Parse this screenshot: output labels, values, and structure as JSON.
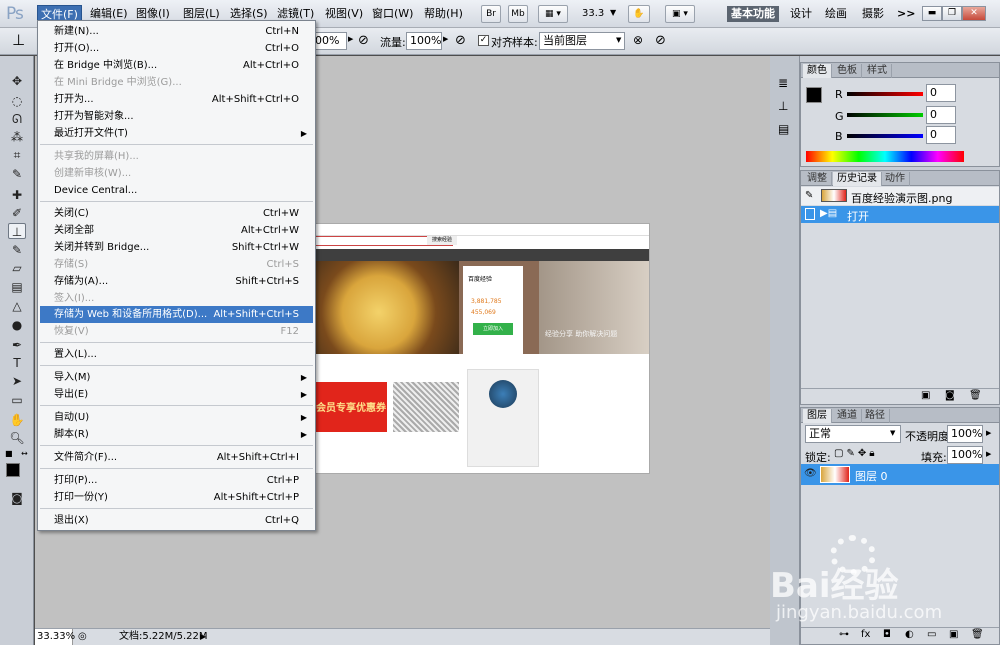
{
  "app": {
    "logo": "Ps"
  },
  "menubar": {
    "items": [
      "文件(F)",
      "编辑(E)",
      "图像(I)",
      "图层(L)",
      "选择(S)",
      "滤镜(T)",
      "视图(V)",
      "窗口(W)",
      "帮助(H)"
    ],
    "br": "Br",
    "mb": "Mb",
    "zoom": "33.3",
    "workspaces": [
      "基本功能",
      "设计",
      "绘画",
      "摄影"
    ],
    "more": ">>"
  },
  "options": {
    "opacity_value": "00%",
    "flow_label": "流量:",
    "flow_value": "100%",
    "align_label": "对齐",
    "sample_label": "样本:",
    "sample_value": "当前图层"
  },
  "file_menu": {
    "items": [
      {
        "label": "新建(N)...",
        "shortcut": "Ctrl+N",
        "state": "normal"
      },
      {
        "label": "打开(O)...",
        "shortcut": "Ctrl+O",
        "state": "normal"
      },
      {
        "label": "在 Bridge 中浏览(B)...",
        "shortcut": "Alt+Ctrl+O",
        "state": "normal"
      },
      {
        "label": "在 Mini Bridge 中浏览(G)...",
        "shortcut": "",
        "state": "disabled"
      },
      {
        "label": "打开为...",
        "shortcut": "Alt+Shift+Ctrl+O",
        "state": "normal"
      },
      {
        "label": "打开为智能对象...",
        "shortcut": "",
        "state": "normal"
      },
      {
        "label": "最近打开文件(T)",
        "shortcut": "",
        "state": "submenu"
      },
      {
        "label": "共享我的屏幕(H)...",
        "shortcut": "",
        "state": "disabled"
      },
      {
        "label": "创建新审核(W)...",
        "shortcut": "",
        "state": "disabled"
      },
      {
        "label": "Device Central...",
        "shortcut": "",
        "state": "normal"
      },
      {
        "label": "关闭(C)",
        "shortcut": "Ctrl+W",
        "state": "normal"
      },
      {
        "label": "关闭全部",
        "shortcut": "Alt+Ctrl+W",
        "state": "normal"
      },
      {
        "label": "关闭并转到 Bridge...",
        "shortcut": "Shift+Ctrl+W",
        "state": "normal"
      },
      {
        "label": "存储(S)",
        "shortcut": "Ctrl+S",
        "state": "disabled"
      },
      {
        "label": "存储为(A)...",
        "shortcut": "Shift+Ctrl+S",
        "state": "normal"
      },
      {
        "label": "签入(I)...",
        "shortcut": "",
        "state": "disabled"
      },
      {
        "label": "存储为 Web 和设备所用格式(D)...",
        "shortcut": "Alt+Shift+Ctrl+S",
        "state": "highlighted"
      },
      {
        "label": "恢复(V)",
        "shortcut": "F12",
        "state": "disabled"
      },
      {
        "label": "置入(L)...",
        "shortcut": "",
        "state": "normal"
      },
      {
        "label": "导入(M)",
        "shortcut": "",
        "state": "submenu"
      },
      {
        "label": "导出(E)",
        "shortcut": "",
        "state": "submenu"
      },
      {
        "label": "自动(U)",
        "shortcut": "",
        "state": "submenu"
      },
      {
        "label": "脚本(R)",
        "shortcut": "",
        "state": "submenu"
      },
      {
        "label": "文件简介(F)...",
        "shortcut": "Alt+Shift+Ctrl+I",
        "state": "normal"
      },
      {
        "label": "打印(P)...",
        "shortcut": "Ctrl+P",
        "state": "normal"
      },
      {
        "label": "打印一份(Y)",
        "shortcut": "Alt+Shift+Ctrl+P",
        "state": "normal"
      },
      {
        "label": "退出(X)",
        "shortcut": "Ctrl+Q",
        "state": "normal"
      }
    ]
  },
  "color_panel": {
    "tabs": [
      "颜色",
      "色板",
      "样式"
    ],
    "r_label": "R",
    "r_value": "0",
    "g_label": "G",
    "g_value": "0",
    "b_label": "B",
    "b_value": "0"
  },
  "history_panel": {
    "tabs": [
      "调整",
      "历史记录",
      "动作"
    ],
    "snapshot": "百度经验演示图.png",
    "step": "打开"
  },
  "layers_panel": {
    "tabs": [
      "图层",
      "通道",
      "路径"
    ],
    "blend_mode": "正常",
    "opacity_label": "不透明度:",
    "opacity_value": "100%",
    "lock_label": "锁定:",
    "fill_label": "填充:",
    "fill_value": "100%",
    "layer_name": "图层 0"
  },
  "status": {
    "zoom": "33.33%",
    "doc": "文档:5.22M/5.22M"
  },
  "doc_image": {
    "search_btn": "搜索经验",
    "card_title": "百度经验",
    "stat1": "3,881,785",
    "stat2": "455,069",
    "green_btn": "立即加入",
    "promo": "会员专享优惠券",
    "caption": "经验分享 助你解决问题"
  },
  "watermark": {
    "brand": "Bai经验",
    "url": "jingyan.baidu.com"
  },
  "colors": {
    "highlight": "#3d79c6",
    "selection": "#3a95e8"
  }
}
